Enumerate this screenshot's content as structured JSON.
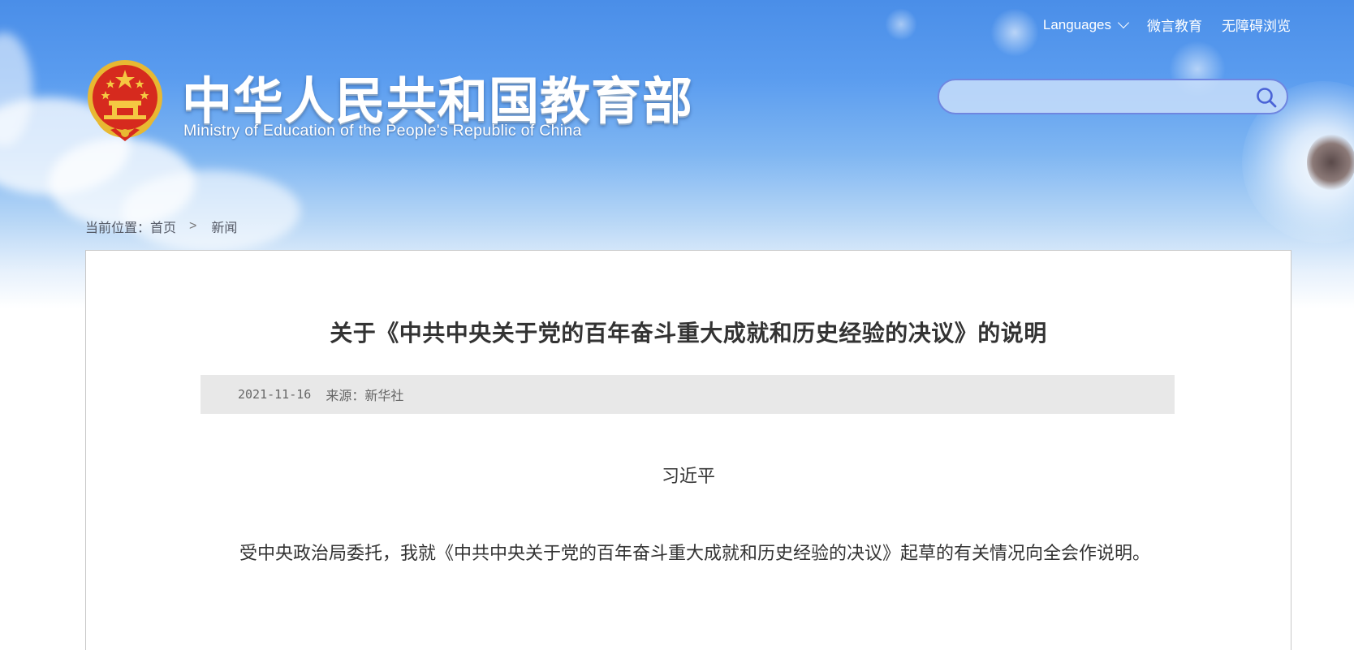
{
  "header": {
    "top_links": {
      "languages": "Languages",
      "weiyan": "微言教育",
      "accessibility": "无障碍浏览"
    },
    "title_cn": "中华人民共和国教育部",
    "title_en": "Ministry of Education of the People's Republic of China",
    "search": {
      "placeholder": "",
      "value": ""
    },
    "colors": {
      "sky_top": "#4a8ee8",
      "search_border": "#6f86e0"
    }
  },
  "breadcrumb": {
    "prefix": "当前位置：",
    "home": "首页",
    "separator": ">",
    "current": "新闻"
  },
  "article": {
    "title": "关于《中共中央关于党的百年奋斗重大成就和历史经验的决议》的说明",
    "date": "2021-11-16",
    "source": "来源：新华社",
    "author": "习近平",
    "paragraph": "受中央政治局委托，我就《中共中央关于党的百年奋斗重大成就和历史经验的决议》起草的有关情况向全会作说明。"
  },
  "icons": {
    "emblem": "national-emblem-icon",
    "search": "search-icon",
    "chevron": "chevron-down-icon"
  }
}
